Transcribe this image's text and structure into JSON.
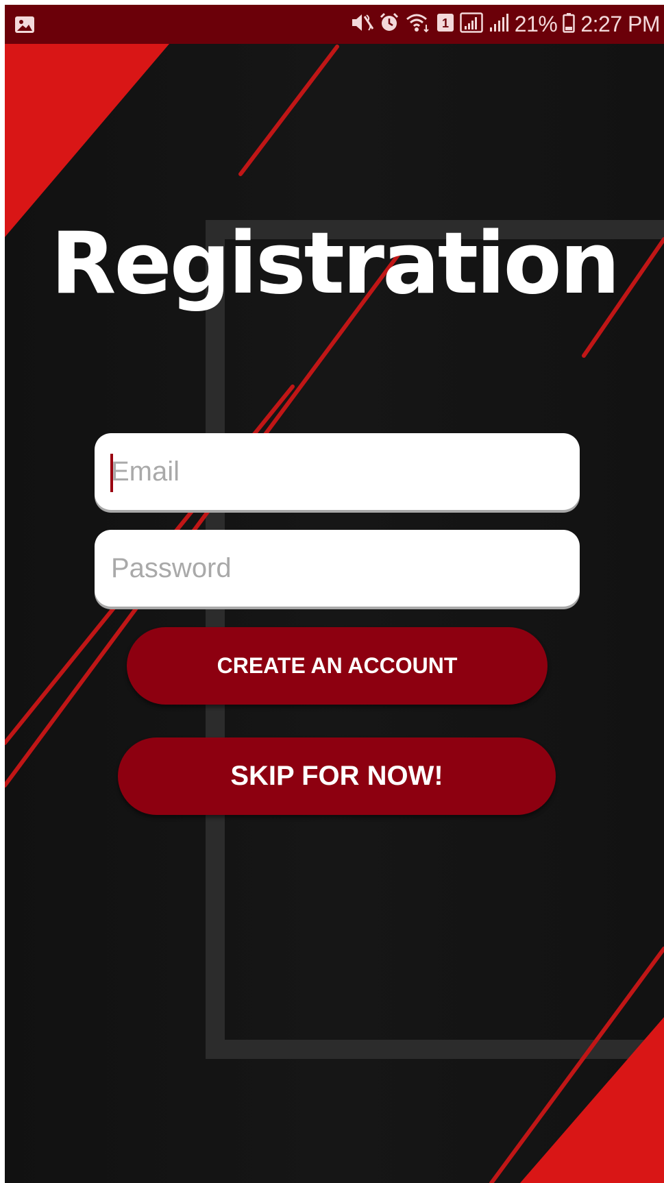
{
  "status_bar": {
    "battery_text": "21%",
    "time": "2:27 PM",
    "sim_badge": "1",
    "icons": [
      "gallery-icon",
      "mute-icon",
      "alarm-icon",
      "wifi-icon",
      "sim-icon",
      "signal-icon",
      "signal-icon",
      "battery-icon"
    ]
  },
  "registration": {
    "title": "Registration",
    "email_placeholder": "Email",
    "password_placeholder": "Password",
    "create_account_label": "CREATE AN ACCOUNT",
    "skip_label": "SKIP FOR NOW!"
  },
  "colors": {
    "status_bar": "#6b0009",
    "background": "#131313",
    "accent_red": "#d91616",
    "button": "#8d0010",
    "field": "#ffffff",
    "placeholder": "#a9a9a9"
  }
}
